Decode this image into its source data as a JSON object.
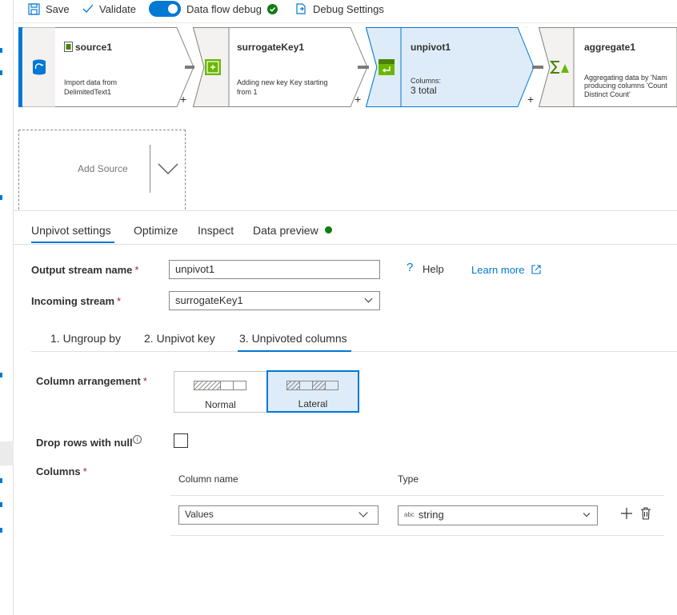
{
  "toolbar": {
    "save_label": "Save",
    "validate_label": "Validate",
    "debug_label": "Data flow debug",
    "debug_settings_label": "Debug Settings"
  },
  "nodes": [
    {
      "title": "source1",
      "desc_line1": "Import data from",
      "desc_line2": "DelimitedText1"
    },
    {
      "title": "surrogateKey1",
      "desc_line1": "Adding new key Key starting",
      "desc_line2": "from 1"
    },
    {
      "title": "unpivot1",
      "desc_line1": "Columns:",
      "desc_line2": "3 total"
    },
    {
      "title": "aggregate1",
      "desc_line1": "Aggregating data by 'Nam",
      "desc_line2": "producing columns 'Count",
      "desc_line3": "Distinct Count'"
    }
  ],
  "canvas": {
    "plus": "+",
    "add_source_label": "Add Source"
  },
  "tabs": [
    {
      "label": "Unpivot settings"
    },
    {
      "label": "Optimize"
    },
    {
      "label": "Inspect"
    },
    {
      "label": "Data preview"
    }
  ],
  "form": {
    "output_stream_label": "Output stream name",
    "output_stream_value": "unpivot1",
    "incoming_stream_label": "Incoming stream",
    "incoming_stream_value": "surrogateKey1",
    "required_mark": "*",
    "help_icon_glyph": "?",
    "help_label": "Help",
    "learn_more_label": "Learn more"
  },
  "subtabs": [
    {
      "label": "1. Ungroup by"
    },
    {
      "label": "2. Unpivot key"
    },
    {
      "label": "3. Unpivoted columns"
    }
  ],
  "unpivoted": {
    "arrangement_label": "Column arrangement",
    "arrangement_options": [
      {
        "label": "Normal",
        "selected": false
      },
      {
        "label": "Lateral",
        "selected": true
      }
    ],
    "drop_null_label": "Drop rows with null",
    "info_icon_glyph": "i",
    "columns_label": "Columns",
    "col_name_header": "Column name",
    "type_header": "Type",
    "row": {
      "name": "Values",
      "type_prefix": "abc",
      "type": "string"
    }
  },
  "colors": {
    "accent": "#0078d4",
    "selected_bg": "#deecf9",
    "success": "#107c10",
    "required": "#a4262c"
  }
}
